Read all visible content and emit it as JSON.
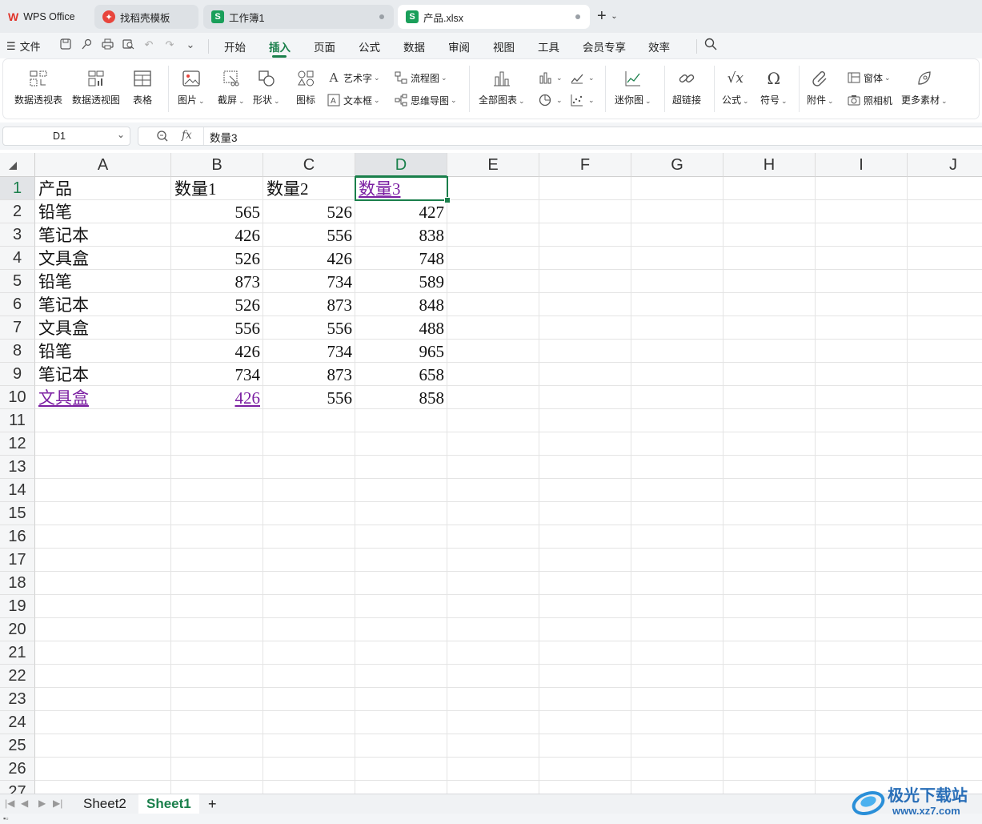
{
  "tabs": [
    {
      "label": "WPS Office",
      "icon": "wps-logo-icon"
    },
    {
      "label": "找稻壳模板",
      "icon": "docer-icon"
    },
    {
      "label": "工作簿1",
      "icon": "sheet-icon"
    },
    {
      "label": "产品.xlsx",
      "icon": "sheet-icon"
    }
  ],
  "new_tab_label": "+",
  "menu": {
    "file": "文件",
    "items": [
      "开始",
      "插入",
      "页面",
      "公式",
      "数据",
      "审阅",
      "视图",
      "工具",
      "会员专享",
      "效率"
    ],
    "active": "插入"
  },
  "ribbon": {
    "pivot_table": "数据透视表",
    "pivot_chart": "数据透视图",
    "table": "表格",
    "picture": "图片",
    "screenshot": "截屏",
    "shape": "形状",
    "icon": "图标",
    "wordart": "艺术字",
    "textbox": "文本框",
    "flowchart": "流程图",
    "mindmap": "思维导图",
    "all_charts": "全部图表",
    "sparkline": "迷你图",
    "hyperlink": "超链接",
    "formula": "公式",
    "symbol": "符号",
    "attachment": "附件",
    "form": "窗体",
    "camera": "照相机",
    "more": "更多素材"
  },
  "formula_bar": {
    "name_box": "D1",
    "fx": "fx",
    "content": "数量3"
  },
  "columns": [
    "A",
    "B",
    "C",
    "D",
    "E",
    "F",
    "G",
    "H",
    "I",
    "J"
  ],
  "selected_column": "D",
  "rows": [
    "1",
    "2",
    "3",
    "4",
    "5",
    "6",
    "7",
    "8",
    "9",
    "10",
    "11",
    "12",
    "13",
    "14",
    "15",
    "16",
    "17",
    "18",
    "19",
    "20",
    "21",
    "22",
    "23",
    "24",
    "25",
    "26",
    "27"
  ],
  "selected_row": "1",
  "table": {
    "header": [
      "产品",
      "数量1",
      "数量2",
      "数量3"
    ],
    "data": [
      [
        "铅笔",
        "565",
        "526",
        "427"
      ],
      [
        "笔记本",
        "426",
        "556",
        "838"
      ],
      [
        "文具盒",
        "526",
        "426",
        "748"
      ],
      [
        "铅笔",
        "873",
        "734",
        "589"
      ],
      [
        "笔记本",
        "526",
        "873",
        "848"
      ],
      [
        "文具盒",
        "556",
        "556",
        "488"
      ],
      [
        "铅笔",
        "426",
        "734",
        "965"
      ],
      [
        "笔记本",
        "734",
        "873",
        "658"
      ],
      [
        "文具盒",
        "426",
        "556",
        "858"
      ]
    ]
  },
  "hyperlink_cells": [
    "D1",
    "A10",
    "B10"
  ],
  "link_color": "#7b1fa2",
  "accent_color": "#1a7f4b",
  "sheets": [
    "Sheet2",
    "Sheet1"
  ],
  "active_sheet": "Sheet1",
  "add_sheet": "+",
  "watermark": {
    "title": "极光下载站",
    "url": "www.xz7.com"
  }
}
